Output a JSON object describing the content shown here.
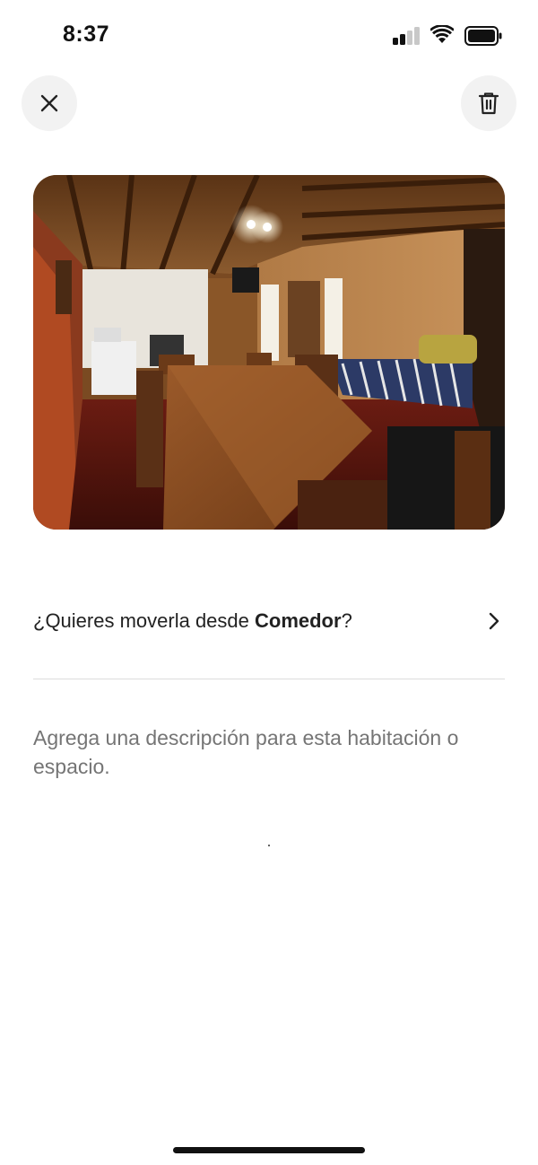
{
  "status_bar": {
    "time": "8:37",
    "signal_icon": "cellular-signal-icon",
    "wifi_icon": "wifi-icon",
    "battery_icon": "battery-icon"
  },
  "top_bar": {
    "close_icon": "close-icon",
    "delete_icon": "trash-icon"
  },
  "photo": {
    "subject": "wooden cabin interior with dining table, kitchen and bed"
  },
  "move_row": {
    "prefix": "¿Quieres moverla desde ",
    "room": "Comedor",
    "suffix": "?",
    "icon": "chevron-right-icon"
  },
  "description": {
    "placeholder": "Agrega una descripción para esta habitación o espacio."
  },
  "colors": {
    "text": "#222222",
    "placeholder": "#b0b0b0",
    "button_bg": "#f2f2f2",
    "divider": "#dddddd"
  }
}
